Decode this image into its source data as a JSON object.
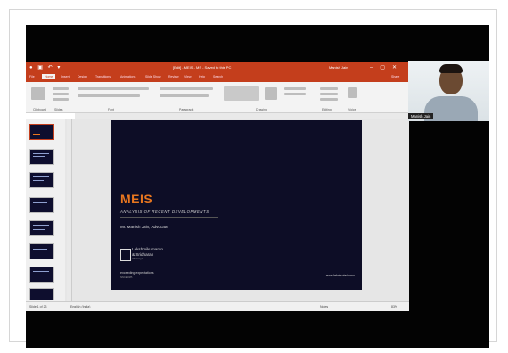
{
  "window": {
    "title": "[Edit] - MEIS - MS - Saved to this PC",
    "user": "Manish Jain",
    "tabs": [
      "File",
      "Home",
      "Insert",
      "Design",
      "Transitions",
      "Animations",
      "Slide Show",
      "Review",
      "View",
      "Help",
      "Search"
    ],
    "active_tab": "Home",
    "groups": [
      "Clipboard",
      "Slides",
      "Font",
      "Paragraph",
      "Drawing",
      "Editing",
      "Voice"
    ],
    "share": "Share"
  },
  "slide": {
    "title": "MEIS",
    "subtitle": "ANALYSIS OF RECENT DEVELOPMENTS",
    "presenter": "Mr. Manish Jain, Advocate",
    "firm_line1": "Lakshmikumaran",
    "firm_line2": "& Sridharan",
    "firm_small": "attorneys",
    "tagline": "exceeding expectations",
    "since": "SINCE 1985",
    "url": "www.lakshmisri.com"
  },
  "statusbar": {
    "slide_info": "Slide 1 of 23",
    "language": "English (India)",
    "notes": "Notes",
    "zoom": "83%"
  },
  "webcam": {
    "participant_name": "Manish Jain"
  },
  "colors": {
    "ppt_accent": "#c43e1c",
    "slide_bg": "#0d0d26",
    "title_orange": "#e8761f"
  }
}
